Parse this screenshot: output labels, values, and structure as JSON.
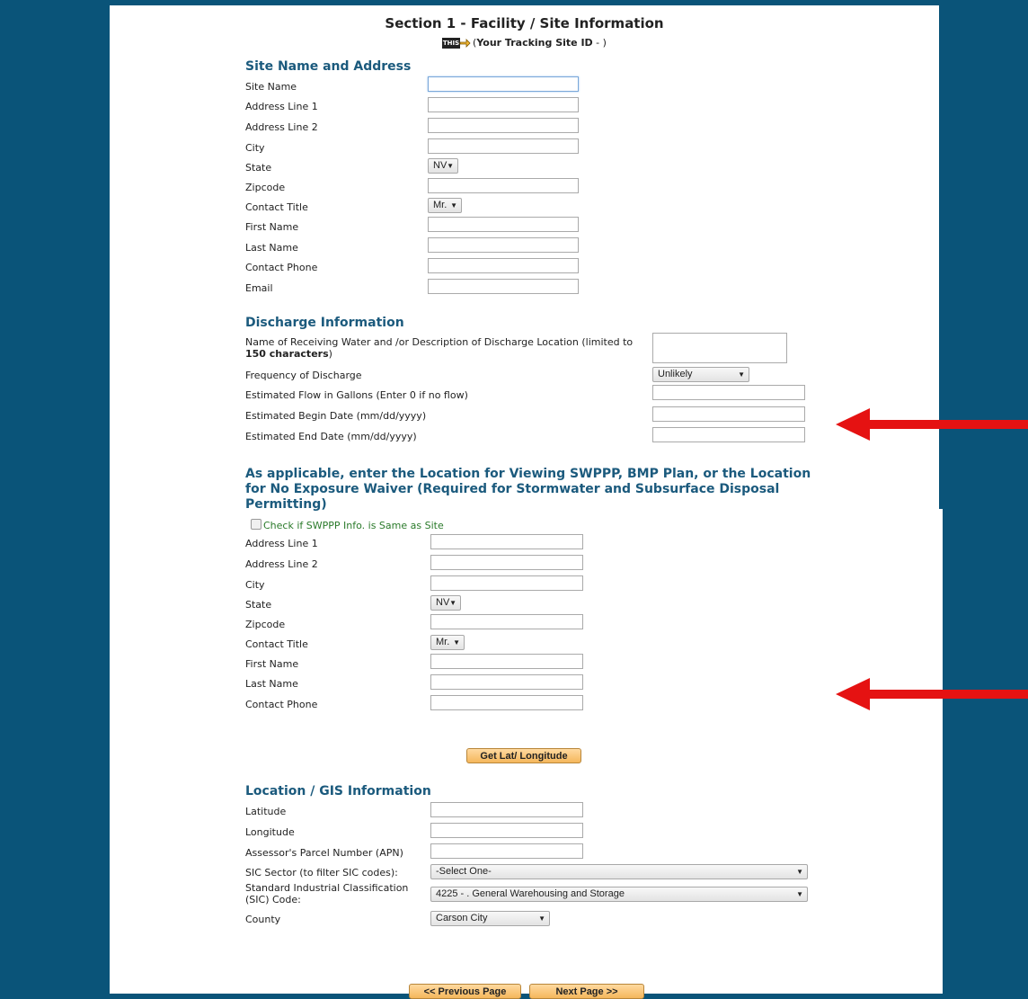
{
  "title": "Section 1 - Facility / Site Information",
  "tracking": {
    "icon_text": "THIS",
    "prefix": "(",
    "label": "Your Tracking Site ID",
    "suffix": " - )"
  },
  "site": {
    "heading": "Site Name and Address",
    "labels": [
      "Site Name",
      "Address Line 1",
      "Address Line 2",
      "City",
      "State",
      "Zipcode",
      "Contact Title",
      "First Name",
      "Last Name",
      "Contact Phone",
      "Email"
    ],
    "state_value": "NV",
    "title_value": "Mr."
  },
  "discharge": {
    "heading": "Discharge Information",
    "receiving_label_a": "Name of Receiving Water and /or Description of Discharge Location (limited to",
    "receiving_label_b": "150 characters",
    "receiving_label_c": ")",
    "frequency_label": "Frequency of Discharge",
    "frequency_value": "Unlikely",
    "flow_label": "Estimated Flow in Gallons (Enter 0 if no flow)",
    "begin_label": "Estimated Begin Date (mm/dd/yyyy)",
    "end_label": "Estimated End Date (mm/dd/yyyy)"
  },
  "swppp": {
    "heading_line1": "As applicable, enter the Location for Viewing SWPPP, BMP Plan, or the Location",
    "heading_line2": "for No Exposure Waiver (Required for Stormwater and Subsurface Disposal",
    "heading_line3": "Permitting)",
    "same_as_site": "Check if SWPPP Info. is Same as Site",
    "labels": [
      "Address Line 1",
      "Address Line 2",
      "City",
      "State",
      "Zipcode",
      "Contact Title",
      "First Name",
      "Last Name",
      "Contact Phone"
    ],
    "state_value": "NV",
    "title_value": "Mr."
  },
  "latlong_button": "Get Lat/ Longitude",
  "gis": {
    "heading": "Location / GIS Information",
    "latitude": "Latitude",
    "longitude": "Longitude",
    "apn": "Assessor's Parcel Number (APN)",
    "sic_sector_label": "SIC Sector (to filter SIC codes):",
    "sic_sector_value": "-Select One-",
    "sic_code_label_1": "Standard Industrial Classification",
    "sic_code_label_2": "(SIC) Code:",
    "sic_code_value": "4225 - . General Warehousing and Storage",
    "county_label": "County",
    "county_value": "Carson City"
  },
  "nav": {
    "prev": "<< Previous Page",
    "next": "Next Page >>"
  },
  "colors": {
    "background": "#0a5479",
    "heading": "#1b5a7d",
    "arrow": "#e51212",
    "button": "#f5b75c"
  }
}
